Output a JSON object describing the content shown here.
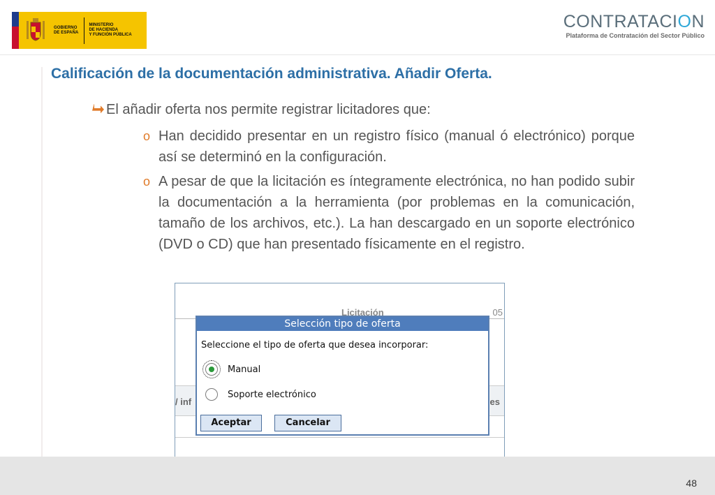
{
  "header": {
    "gov_logo_text_left": "GOBIERNO\nDE ESPAÑA",
    "gov_logo_text_right": "MINISTERIO\nDE HACIENDA\nY FUNCIÓN PÚBLICA",
    "contratacion_logo_prefix": "CONTRATACI",
    "contratacion_logo_power": "O",
    "contratacion_logo_suffix": "N",
    "contratacion_subtitle": "Plataforma de Contratación del Sector Público"
  },
  "slide": {
    "title": "Calificación de la documentación administrativa. Añadir Oferta.",
    "bullet": "El añadir oferta nos permite registrar licitadores que:",
    "sub_marker": "o",
    "sub_items": [
      "Han decidido presentar en un registro físico (manual ó electrónico) porque así se determinó en la configuración.",
      "A pesar de que la licitación es íntegramente electrónica, no han podido subir la documentación a la herramienta (por problemas en la comunicación, tamaño de los archivos, etc.). La han descargado en un soporte electrónico (DVD o CD) que han presentado  físicamente en el registro."
    ],
    "page_number": "48"
  },
  "screenshot": {
    "background": {
      "licitacion_label": "Licitación",
      "number_fragment": "05",
      "left_fragment": "/ inf",
      "right_fragment": "es"
    },
    "dialog": {
      "title": "Selección tipo de oferta",
      "prompt": "Seleccione el tipo de oferta que desea incorporar:",
      "options": [
        {
          "label": "Manual",
          "selected": true
        },
        {
          "label": "Soporte electrónico",
          "selected": false
        }
      ],
      "accept_label": "Aceptar",
      "cancel_label": "Cancelar"
    }
  },
  "colors": {
    "title_blue": "#2d6fa6",
    "dialog_header": "#4f7dbc",
    "bullet_arrow": "#e07b2a",
    "logo_yellow": "#f5c400"
  }
}
